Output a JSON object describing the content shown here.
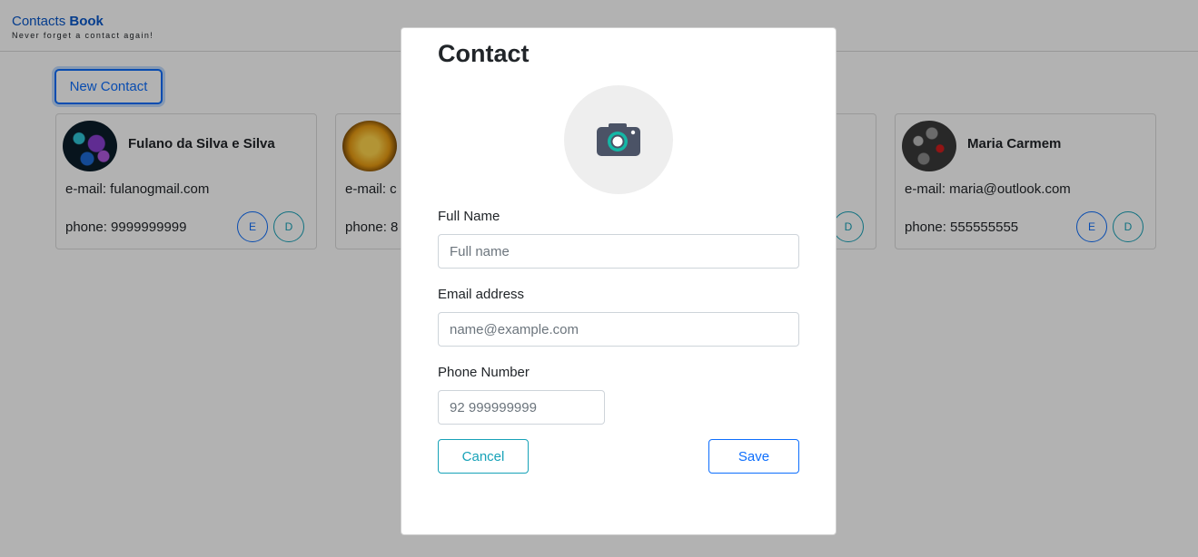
{
  "header": {
    "brand_prefix": "Contacts",
    "brand_bold": "Book",
    "tagline": "Never forget a contact again!"
  },
  "toolbar": {
    "new_contact_label": "New Contact"
  },
  "cards": [
    {
      "name": "Fulano da Silva e Silva",
      "email": "e-mail: fulanogmail.com",
      "phone": "phone: 9999999999",
      "edit_label": "E",
      "delete_label": "D"
    },
    {
      "name": "",
      "email": "e-mail: c",
      "phone": "phone: 8",
      "edit_label": "",
      "delete_label": ""
    },
    {
      "name": "",
      "email": "",
      "phone": "",
      "edit_label": "",
      "delete_label": "D"
    },
    {
      "name": "Maria Carmem",
      "email": "e-mail: maria@outlook.com",
      "phone": "phone: 555555555",
      "edit_label": "E",
      "delete_label": "D"
    }
  ],
  "modal": {
    "title": "Contact",
    "fullname_label": "Full Name",
    "fullname_placeholder": "Full name",
    "email_label": "Email address",
    "email_placeholder": "name@example.com",
    "phone_label": "Phone Number",
    "phone_placeholder": "92 999999999",
    "cancel_label": "Cancel",
    "save_label": "Save"
  },
  "colors": {
    "primary": "#0d6efd",
    "info": "#17a2b8",
    "brand": "#0a58ca"
  }
}
